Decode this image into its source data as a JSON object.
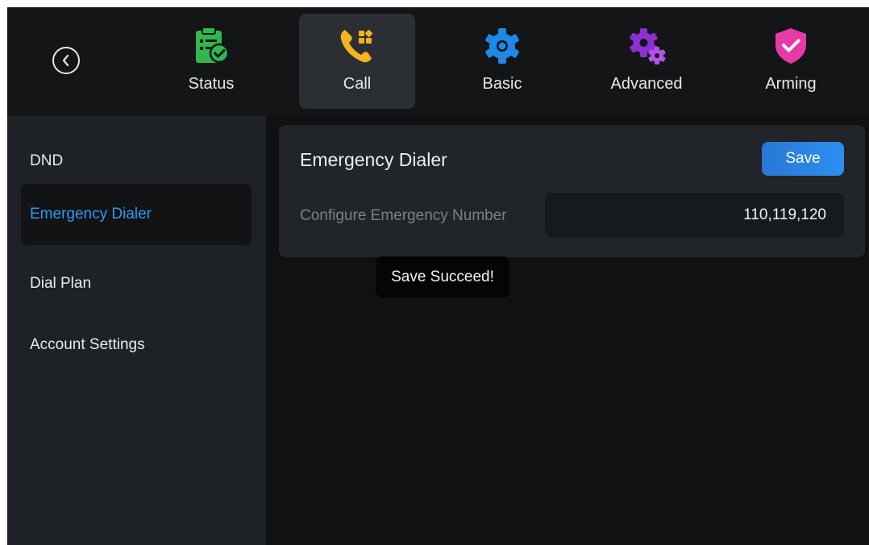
{
  "topbar": {
    "tabs": [
      {
        "label": "Status",
        "icon": "clipboard-check-icon",
        "color": "#2fb84f"
      },
      {
        "label": "Call",
        "icon": "phone-grid-icon",
        "color": "#f4b51c",
        "active": true
      },
      {
        "label": "Basic",
        "icon": "gear-icon",
        "color": "#1e88e5"
      },
      {
        "label": "Advanced",
        "icon": "double-gear-icon",
        "color": "#9b34d6"
      },
      {
        "label": "Arming",
        "icon": "shield-check-icon",
        "color": "#e83aa6"
      }
    ],
    "back_icon": "chevron-left-icon"
  },
  "sidebar": {
    "items": [
      {
        "label": "DND"
      },
      {
        "label": "Emergency Dialer",
        "active": true
      },
      {
        "label": "Dial Plan"
      },
      {
        "label": "Account Settings"
      }
    ]
  },
  "panel": {
    "title": "Emergency Dialer",
    "save_label": "Save",
    "field_label": "Configure Emergency Number",
    "field_value": "110,119,120"
  },
  "toast": {
    "text": "Save Succeed!"
  },
  "colors": {
    "accent": "#2f9bf0",
    "save_button": "#2c8ff0"
  }
}
